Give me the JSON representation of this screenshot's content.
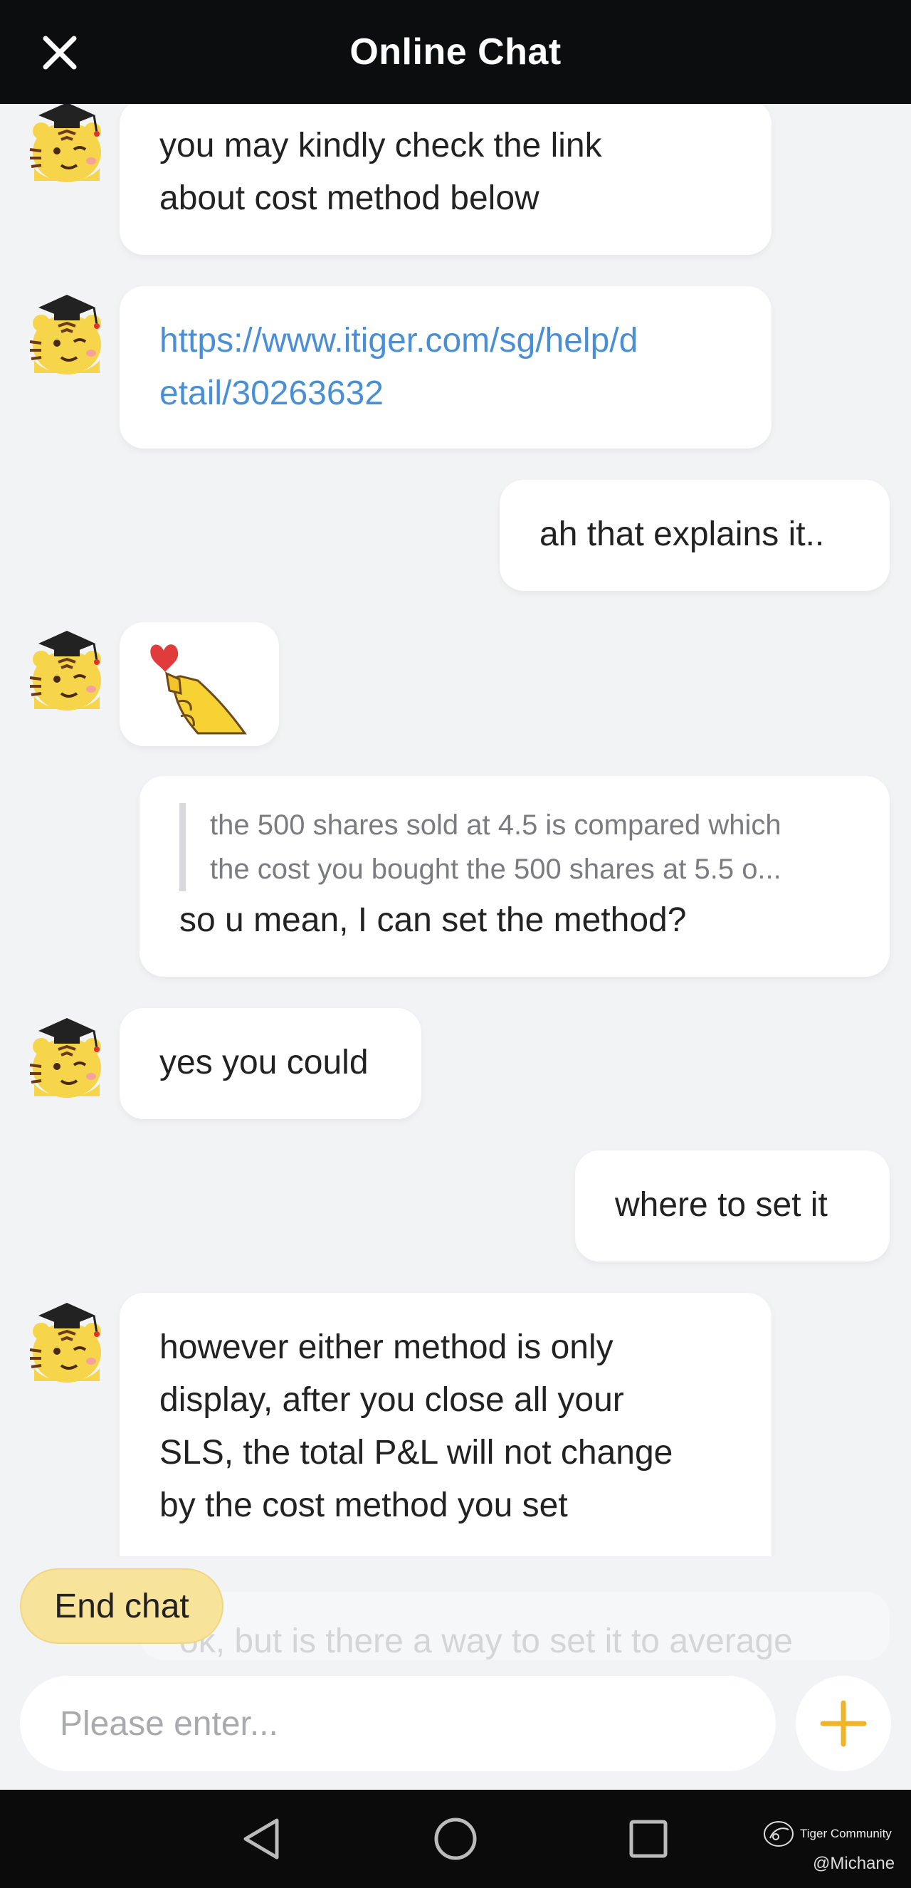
{
  "header": {
    "title": "Online Chat",
    "close_icon": "close-icon"
  },
  "messages": [
    {
      "sender": "agent",
      "text": "you may kindly check the link about cost method below",
      "lines": [
        "you may kindly check the link",
        "about cost method below"
      ]
    },
    {
      "sender": "agent",
      "type": "link",
      "lines": [
        "https://www.itiger.com/sg/help/d",
        "etail/30263632"
      ]
    },
    {
      "sender": "user",
      "text": "ah that explains it.."
    },
    {
      "sender": "agent",
      "type": "sticker",
      "sticker": "hand-heart-sticker"
    },
    {
      "sender": "user",
      "quote_lines": [
        "the 500 shares sold at 4.5 is compared which",
        "the cost you bought the 500 shares at 5.5 o..."
      ],
      "text": "so u mean, I can set the method?"
    },
    {
      "sender": "agent",
      "text": "yes you could"
    },
    {
      "sender": "user",
      "text": "where to set it"
    },
    {
      "sender": "agent",
      "lines": [
        "however either method is only",
        "display, after you close all your",
        "SLS, the total P&L will not change",
        "by the cost method you set"
      ]
    }
  ],
  "footer": {
    "end_chat_label": "End chat",
    "preview_text": "ok, but is there a way to set it to average",
    "input_placeholder": "Please enter...",
    "plus_icon": "plus-icon",
    "accent_color": "#f0b429"
  },
  "system_nav": {
    "back_icon": "back-triangle-icon",
    "home_icon": "home-circle-icon",
    "recents_icon": "recents-square-icon"
  },
  "watermark": {
    "brand": "Tiger Community",
    "user": "@Michane"
  }
}
